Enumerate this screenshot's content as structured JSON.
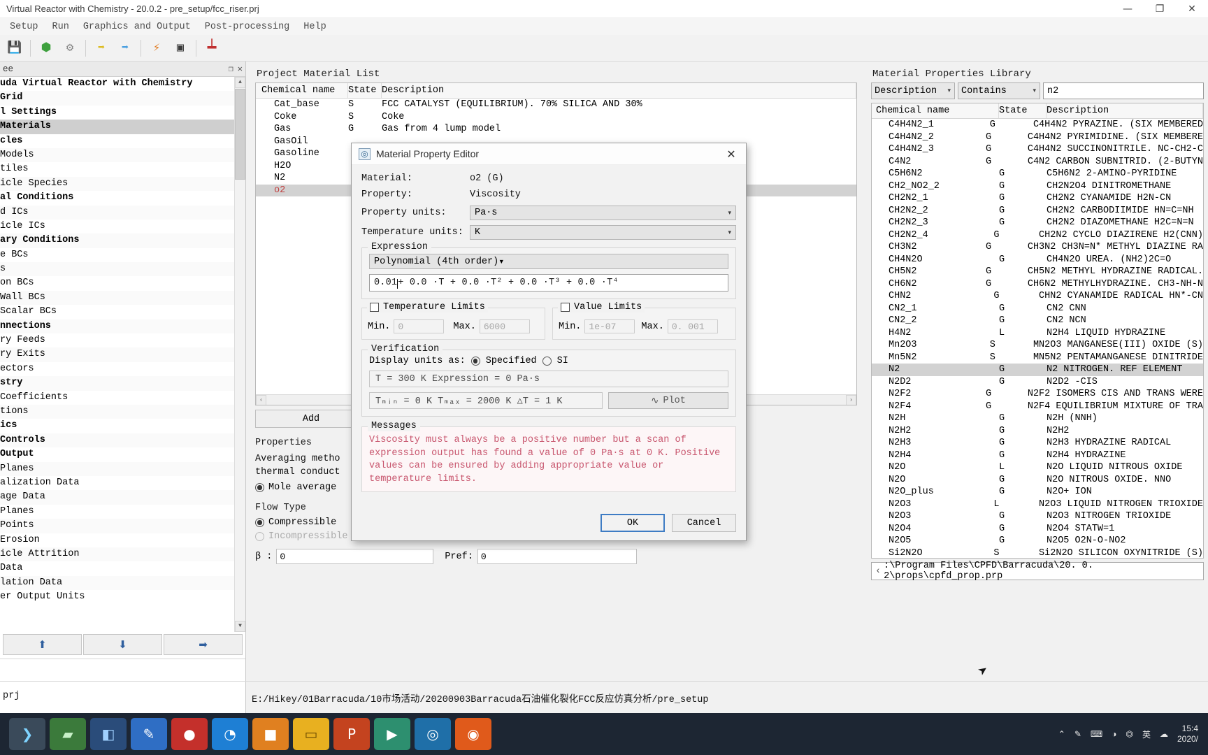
{
  "window": {
    "title": "Virtual Reactor with Chemistry - 20.0.2 - pre_setup/fcc_riser.prj",
    "minimize": "—",
    "maximize": "❐",
    "close": "✕"
  },
  "menu": [
    "Setup",
    "Run",
    "Graphics and Output",
    "Post-processing",
    "Help"
  ],
  "toolbar": [
    {
      "name": "save-icon",
      "glyph": "💾",
      "color": "#7a7a7a"
    },
    {
      "name": "grid-generate-icon",
      "glyph": "⬢",
      "color": "#3ea03e"
    },
    {
      "name": "settings-gear-icon",
      "glyph": "⚙",
      "color": "#888888"
    },
    {
      "name": "run-step1-icon",
      "glyph": "➡",
      "color": "#e0c030"
    },
    {
      "name": "run-all-icon",
      "glyph": "➡",
      "color": "#4a9fe0"
    },
    {
      "name": "flash-icon",
      "glyph": "⚡",
      "color": "#e07a20"
    },
    {
      "name": "terminal-icon",
      "glyph": "▣",
      "color": "#3a3a3a"
    },
    {
      "name": "grid-icon",
      "glyph": "⌗",
      "color": "#c03030"
    }
  ],
  "tree": {
    "panel_label": "ee",
    "restore_icon": "❐",
    "close_icon": "✕",
    "nodes": [
      {
        "label": "uda Virtual Reactor with Chemistry",
        "bold": true,
        "sel": false
      },
      {
        "label": "  Grid",
        "bold": true,
        "sel": false
      },
      {
        "label": "l Settings",
        "bold": true,
        "sel": false
      },
      {
        "label": "Materials",
        "bold": true,
        "sel": true
      },
      {
        "label": "cles",
        "bold": true,
        "sel": false
      },
      {
        "label": " Models",
        "bold": false,
        "sel": false
      },
      {
        "label": "tiles",
        "bold": false,
        "sel": false
      },
      {
        "label": "icle Species",
        "bold": false,
        "sel": false
      },
      {
        "label": "al Conditions",
        "bold": true,
        "sel": false
      },
      {
        "label": "d ICs",
        "bold": false,
        "sel": false
      },
      {
        "label": "icle ICs",
        "bold": false,
        "sel": false
      },
      {
        "label": "ary Conditions",
        "bold": true,
        "sel": false
      },
      {
        "label": "e BCs",
        "bold": false,
        "sel": false
      },
      {
        "label": "s",
        "bold": false,
        "sel": false
      },
      {
        "label": "on BCs",
        "bold": false,
        "sel": false
      },
      {
        "label": "  Wall BCs",
        "bold": false,
        "sel": false
      },
      {
        "label": "  Scalar BCs",
        "bold": false,
        "sel": false
      },
      {
        "label": "nnections",
        "bold": true,
        "sel": false
      },
      {
        "label": "ry Feeds",
        "bold": false,
        "sel": false
      },
      {
        "label": "ry Exits",
        "bold": false,
        "sel": false
      },
      {
        "label": "ectors",
        "bold": false,
        "sel": false
      },
      {
        "label": "stry",
        "bold": true,
        "sel": false
      },
      {
        "label": " Coefficients",
        "bold": false,
        "sel": false
      },
      {
        "label": "tions",
        "bold": false,
        "sel": false
      },
      {
        "label": "ics",
        "bold": true,
        "sel": false
      },
      {
        "label": "Controls",
        "bold": true,
        "sel": false
      },
      {
        "label": "Output",
        "bold": true,
        "sel": false
      },
      {
        "label": " Planes",
        "bold": false,
        "sel": false
      },
      {
        "label": "alization Data",
        "bold": false,
        "sel": false
      },
      {
        "label": "age Data",
        "bold": false,
        "sel": false
      },
      {
        "label": " Planes",
        "bold": false,
        "sel": false
      },
      {
        "label": " Points",
        "bold": false,
        "sel": false
      },
      {
        "label": " Erosion",
        "bold": false,
        "sel": false
      },
      {
        "label": "icle Attrition",
        "bold": false,
        "sel": false
      },
      {
        "label": "Data",
        "bold": false,
        "sel": false
      },
      {
        "label": "lation Data",
        "bold": false,
        "sel": false
      },
      {
        "label": "er Output Units",
        "bold": false,
        "sel": false
      }
    ],
    "buttons": [
      {
        "name": "move-up-button",
        "glyph": "⬆"
      },
      {
        "name": "move-down-button",
        "glyph": "⬇"
      },
      {
        "name": "move-right-button",
        "glyph": "➡"
      }
    ]
  },
  "project_list": {
    "title": "Project Material List",
    "columns": [
      "Chemical name",
      "State",
      "Description"
    ],
    "rows": [
      {
        "name": "Cat_base",
        "state": "S",
        "desc": "FCC CATALYST (EQUILIBRIUM). 70% SILICA AND 30%",
        "sel": false
      },
      {
        "name": "Coke",
        "state": "S",
        "desc": "Coke",
        "sel": false
      },
      {
        "name": "Gas",
        "state": "G",
        "desc": "Gas from 4 lump model",
        "sel": false
      },
      {
        "name": "GasOil",
        "state": "",
        "desc": "",
        "sel": false
      },
      {
        "name": "Gasoline",
        "state": "",
        "desc": "",
        "sel": false
      },
      {
        "name": "H2O",
        "state": "",
        "desc": "",
        "sel": false
      },
      {
        "name": "N2",
        "state": "",
        "desc": "",
        "sel": false
      },
      {
        "name": "o2",
        "state": "",
        "desc": "",
        "sel": true
      }
    ],
    "add_button": "Add",
    "scroll_left": "‹",
    "scroll_right": "›"
  },
  "properties": {
    "title": "Properties",
    "averaging_label_line1": "Averaging metho",
    "averaging_label_line2": "thermal conduct",
    "mole_average": "Mole average",
    "flow_type_title": "Flow Type",
    "compressible": "Compressible",
    "incompressible": "Incompressible",
    "beta_label": "β :",
    "beta_value": "0",
    "pref_label": "Pref:",
    "pref_value": "0"
  },
  "library": {
    "title": "Material Properties Library",
    "filter_field": "Description",
    "filter_op": "Contains",
    "search_value": "n2",
    "columns": [
      "Chemical name",
      "State",
      "Description"
    ],
    "path": ":\\Program Files\\CPFD\\Barracuda\\20. 0. 2\\props\\cpfd_prop.prp",
    "scroll_left": "‹",
    "rows": [
      {
        "name": "C4H4N2_1",
        "state": "G",
        "desc": "C4H4N2 PYRAZINE. (SIX MEMBERED",
        "sel": false
      },
      {
        "name": "C4H4N2_2",
        "state": "G",
        "desc": "C4H4N2 PYRIMIDINE. (SIX MEMBERE",
        "sel": false
      },
      {
        "name": "C4H4N2_3",
        "state": "G",
        "desc": "C4H4N2 SUCCINONITRILE. NC-CH2-C",
        "sel": false
      },
      {
        "name": "C4N2",
        "state": "G",
        "desc": "C4N2 CARBON SUBNITRID. (2-BUTYN",
        "sel": false
      },
      {
        "name": "C5H6N2",
        "state": "G",
        "desc": "C5H6N2 2-AMINO-PYRIDINE",
        "sel": false
      },
      {
        "name": "CH2_NO2_2",
        "state": "G",
        "desc": "CH2N2O4 DINITROMETHANE",
        "sel": false
      },
      {
        "name": "CH2N2_1",
        "state": "G",
        "desc": "CH2N2 CYANAMIDE H2N-CN",
        "sel": false
      },
      {
        "name": "CH2N2_2",
        "state": "G",
        "desc": "CH2N2 CARBODIIMIDE HN=C=NH",
        "sel": false
      },
      {
        "name": "CH2N2_3",
        "state": "G",
        "desc": "CH2N2 DIAZOMETHANE H2C=N=N",
        "sel": false
      },
      {
        "name": "CH2N2_4",
        "state": "G",
        "desc": "CH2N2 CYCLO DIAZIRENE H2(CNN)",
        "sel": false
      },
      {
        "name": "CH3N2",
        "state": "G",
        "desc": "CH3N2 CH3N=N* METHYL DIAZINE RA",
        "sel": false
      },
      {
        "name": "CH4N2O",
        "state": "G",
        "desc": "CH4N2O UREA. (NH2)2C=O",
        "sel": false
      },
      {
        "name": "CH5N2",
        "state": "G",
        "desc": "CH5N2 METHYL HYDRAZINE RADICAL.",
        "sel": false
      },
      {
        "name": "CH6N2",
        "state": "G",
        "desc": "CH6N2 METHYLHYDRAZINE. CH3-NH-N",
        "sel": false
      },
      {
        "name": "CHN2",
        "state": "G",
        "desc": "CHN2 CYANAMIDE RADICAL HN*-CN",
        "sel": false
      },
      {
        "name": "CN2_1",
        "state": "G",
        "desc": "CN2 CNN",
        "sel": false
      },
      {
        "name": "CN2_2",
        "state": "G",
        "desc": "CN2 NCN",
        "sel": false
      },
      {
        "name": "H4N2",
        "state": "L",
        "desc": "N2H4 LIQUID HYDRAZINE",
        "sel": false
      },
      {
        "name": "Mn2O3",
        "state": "S",
        "desc": "MN2O3 MANGANESE(III) OXIDE (S)",
        "sel": false
      },
      {
        "name": "Mn5N2",
        "state": "S",
        "desc": "MN5N2 PENTAMANGANESE DINITRIDE",
        "sel": false
      },
      {
        "name": "N2",
        "state": "G",
        "desc": "N2 NITROGEN. REF ELEMENT",
        "sel": true
      },
      {
        "name": "N2D2",
        "state": "G",
        "desc": "N2D2 -CIS",
        "sel": false
      },
      {
        "name": "N2F2",
        "state": "G",
        "desc": "N2F2 ISOMERS CIS AND TRANS WERE",
        "sel": false
      },
      {
        "name": "N2F4",
        "state": "G",
        "desc": "N2F4 EQUILIBRIUM MIXTURE OF TRA",
        "sel": false
      },
      {
        "name": "N2H",
        "state": "G",
        "desc": "N2H (NNH)",
        "sel": false
      },
      {
        "name": "N2H2",
        "state": "G",
        "desc": "N2H2",
        "sel": false
      },
      {
        "name": "N2H3",
        "state": "G",
        "desc": "N2H3 HYDRAZINE RADICAL",
        "sel": false
      },
      {
        "name": "N2H4",
        "state": "G",
        "desc": "N2H4 HYDRAZINE",
        "sel": false
      },
      {
        "name": "N2O",
        "state": "L",
        "desc": "N2O LIQUID NITROUS OXIDE",
        "sel": false
      },
      {
        "name": "N2O",
        "state": "G",
        "desc": "N2O NITROUS OXIDE. NNO",
        "sel": false
      },
      {
        "name": "N2O_plus",
        "state": "G",
        "desc": "N2O+ ION",
        "sel": false
      },
      {
        "name": "N2O3",
        "state": "L",
        "desc": "N2O3 LIQUID NITROGEN TRIOXIDE",
        "sel": false
      },
      {
        "name": "N2O3",
        "state": "G",
        "desc": "N2O3 NITROGEN TRIOXIDE",
        "sel": false
      },
      {
        "name": "N2O4",
        "state": "G",
        "desc": "N2O4 STATW=1",
        "sel": false
      },
      {
        "name": "N2O5",
        "state": "G",
        "desc": "N2O5 O2N-O-NO2",
        "sel": false
      },
      {
        "name": "Si2N2O",
        "state": "S",
        "desc": "Si2N2O SILICON OXYNITRIDE (S)",
        "sel": false
      }
    ]
  },
  "dialog": {
    "title": "Material Property Editor",
    "icon": "◎",
    "close": "✕",
    "material_label": "Material:",
    "material_value": "o2 (G)",
    "property_label": "Property:",
    "property_value": "Viscosity",
    "property_units_label": "Property units:",
    "property_units_value": "Pa·s",
    "temperature_units_label": "Temperature units:",
    "temperature_units_value": "K",
    "expression_title": "Expression",
    "expression_type": "Polynomial (4th order)",
    "expression_value": "0.01",
    "expression_rest": " + 0.0 ·T + 0.0 ·T² + 0.0 ·T³ + 0.0 ·T⁴",
    "temperature_limits_label": "Temperature Limits",
    "temp_min_label": "Min.",
    "temp_min_value": "0",
    "temp_max_label": "Max.",
    "temp_max_value": "6000",
    "value_limits_label": "Value Limits",
    "value_min_label": "Min.",
    "value_min_value": "1e-07",
    "value_max_label": "Max.",
    "value_max_value": "0. 001",
    "verification_title": "Verification",
    "display_units_label": "Display units as:",
    "display_specified": "Specified",
    "display_si": "SI",
    "verify_line1": "T = 300 K     Expression = 0 Pa·s",
    "verify_tmin": "Tₘᵢₙ = 0 K     Tₘₐₓ = 2000 K      △T = 1 K",
    "plot_button": "Plot",
    "plot_icon": "∿",
    "messages_title": "Messages",
    "message_text": "Viscosity must always be a positive number but a scan of expression output has found a value of 0 Pa·s at 0 K. Positive values can be ensured by adding appropriate value or temperature limits.",
    "ok_button": "OK",
    "cancel_button": "Cancel",
    "mouse_cursor": "➤"
  },
  "status": {
    "left": "prj",
    "path": "E:/Hikey/01Barracuda/10市场活动/20200903Barracuda石油催化裂化FCC反应仿真分析/pre_setup"
  },
  "taskbar": {
    "items": [
      {
        "name": "terminal-icon",
        "glyph": "❯",
        "color": "#3a4a5a",
        "text": "#7fd4ff"
      },
      {
        "name": "folder-green-icon",
        "glyph": "▰",
        "color": "#3b7a3b",
        "text": "#c8f0c8"
      },
      {
        "name": "store-icon",
        "glyph": "◧",
        "color": "#2a4c7a",
        "text": "#9fd0ff"
      },
      {
        "name": "editor-icon",
        "glyph": "✎",
        "color": "#2f6ec4",
        "text": "#ffffff"
      },
      {
        "name": "opera-icon",
        "glyph": "●",
        "color": "#c4302b",
        "text": "#ffffff"
      },
      {
        "name": "edge-icon",
        "glyph": "◔",
        "color": "#1e7fd4",
        "text": "#ffffff"
      },
      {
        "name": "app-orange-icon",
        "glyph": "■",
        "color": "#e08020",
        "text": "#ffffff"
      },
      {
        "name": "explorer-icon",
        "glyph": "▭",
        "color": "#e8b020",
        "text": "#6b4a00"
      },
      {
        "name": "powerpoint-icon",
        "glyph": "P",
        "color": "#c4431f",
        "text": "#ffffff"
      },
      {
        "name": "media-icon",
        "glyph": "▶",
        "color": "#2d8f6f",
        "text": "#ffffff"
      },
      {
        "name": "barracuda-icon",
        "glyph": "◎",
        "color": "#1f6fa8",
        "text": "#ffffff"
      },
      {
        "name": "firefox-icon",
        "glyph": "◉",
        "color": "#e05a1b",
        "text": "#ffffff"
      }
    ],
    "tray": [
      {
        "name": "chevron-up-icon",
        "glyph": "⌃"
      },
      {
        "name": "pen-icon",
        "glyph": "✎"
      },
      {
        "name": "keyboard-icon",
        "glyph": "⌨"
      },
      {
        "name": "wifi-icon",
        "glyph": "◔"
      },
      {
        "name": "volume-icon",
        "glyph": "ⓧ"
      },
      {
        "name": "ime-icon",
        "glyph": "英"
      },
      {
        "name": "cloud-icon",
        "glyph": "☁"
      }
    ],
    "clock_time": "15:4",
    "clock_date": "2020/"
  }
}
